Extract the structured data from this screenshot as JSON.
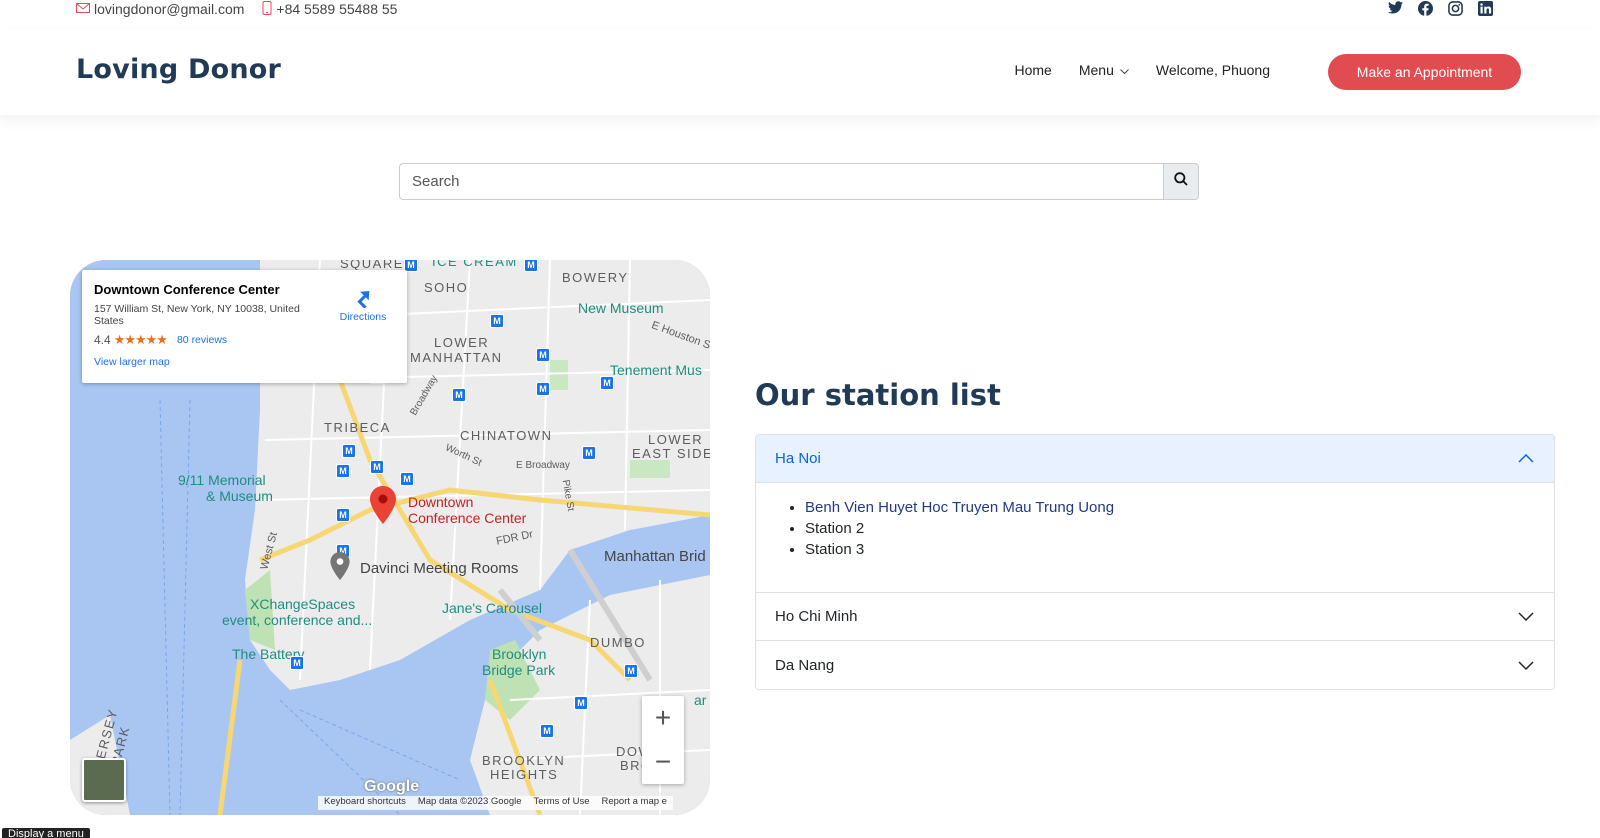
{
  "topbar": {
    "email": "lovingdonor@gmail.com",
    "phone": "+84 5589 55488 55",
    "social": [
      "twitter-icon",
      "facebook-icon",
      "instagram-icon",
      "linkedin-icon"
    ]
  },
  "header": {
    "logo": "Loving Donor",
    "nav": {
      "home": "Home",
      "menu": "Menu",
      "welcome": "Welcome, Phuong"
    },
    "appointment_label": "Make an Appointment"
  },
  "search": {
    "placeholder": "Search"
  },
  "map": {
    "card": {
      "title": "Downtown Conference Center",
      "address": "157 William St, New York, NY 10038, United States",
      "rating": "4.4",
      "stars": "★★★★★",
      "reviews": "80 reviews",
      "larger": "View larger map",
      "directions": "Directions"
    },
    "labels": {
      "square": "SQUARE",
      "icecream": "ICE CREAM",
      "bowery": "BOWERY",
      "soho": "SOHO",
      "new_museum": "New Museum",
      "houston": "E Houston St",
      "lower": "LOWER",
      "manhattan": "MANHATTAN",
      "tenement": "Tenement Mus",
      "tribeca": "TRIBECA",
      "broadway": "Broadway",
      "chinatown": "CHINATOWN",
      "lower_east": "LOWER",
      "east_side": "EAST SIDE",
      "worth": "Worth St",
      "e_broadway": "E Broadway",
      "memorial1": "9/11 Memorial",
      "memorial2": "& Museum",
      "pike": "Pike St",
      "downtown1": "Downtown",
      "downtown2": "Conference Center",
      "fdr": "FDR Dr",
      "manhattan_bridge": "Manhattan Brid",
      "west_st": "West St",
      "davinci": "Davinci Meeting Rooms",
      "xchange1": "XChangeSpaces",
      "xchange2": "event, conference and...",
      "janes": "Jane's Carousel",
      "dumbo": "DUMBO",
      "battery": "The Battery",
      "brooklyn_park1": "Brooklyn",
      "brooklyn_park2": "Bridge Park",
      "jersey": "JERSEY",
      "park": "PARK",
      "brooklyn": "BROOKLYN",
      "heights": "HEIGHTS",
      "dow": "DOW",
      "bro": "BRO",
      "ar": "ar"
    },
    "metro_letter": "M",
    "google": "Google",
    "attrib": {
      "shortcuts": "Keyboard shortcuts",
      "mapdata": "Map data ©2023 Google",
      "terms": "Terms of Use",
      "report": "Report a map e"
    },
    "zoom_in": "+",
    "zoom_out": "−"
  },
  "stations": {
    "title": "Our station list",
    "regions": [
      {
        "name": "Ha Noi",
        "expanded": true,
        "items": [
          "Benh Vien Huyet Hoc Truyen Mau Trung Uong",
          "Station 2",
          "Station 3"
        ]
      },
      {
        "name": "Ho Chi Minh",
        "expanded": false
      },
      {
        "name": "Da Nang",
        "expanded": false
      }
    ]
  },
  "tooltip": "Display a menu",
  "colors": {
    "brand_navy": "#213a56",
    "accent_red": "#e04c4f",
    "accordion_active_bg": "#e7f1ff",
    "accordion_active_text": "#0c63e4",
    "link_blue": "#1a73e8"
  }
}
